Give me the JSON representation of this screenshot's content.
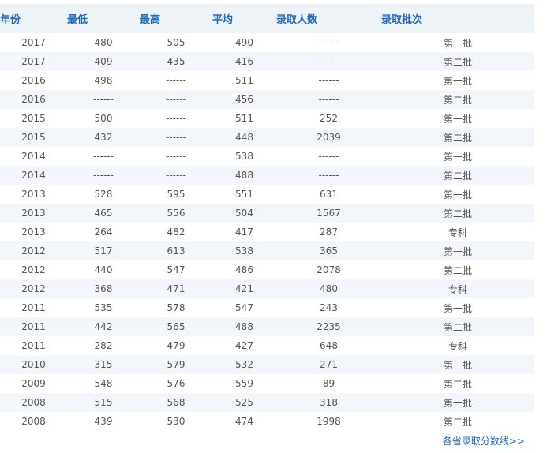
{
  "table": {
    "headers": {
      "year": "年份",
      "min": "最低",
      "max": "最高",
      "avg": "平均",
      "count": "录取人数",
      "batch": "录取批次"
    },
    "rows": [
      {
        "year": "2017",
        "min": "480",
        "max": "505",
        "avg": "490",
        "count": "------",
        "batch": "第一批"
      },
      {
        "year": "2017",
        "min": "409",
        "max": "435",
        "avg": "416",
        "count": "------",
        "batch": "第二批"
      },
      {
        "year": "2016",
        "min": "498",
        "max": "------",
        "avg": "511",
        "count": "------",
        "batch": "第一批"
      },
      {
        "year": "2016",
        "min": "------",
        "max": "------",
        "avg": "456",
        "count": "------",
        "batch": "第二批"
      },
      {
        "year": "2015",
        "min": "500",
        "max": "------",
        "avg": "511",
        "count": "252",
        "batch": "第一批"
      },
      {
        "year": "2015",
        "min": "432",
        "max": "------",
        "avg": "448",
        "count": "2039",
        "batch": "第二批"
      },
      {
        "year": "2014",
        "min": "------",
        "max": "------",
        "avg": "538",
        "count": "------",
        "batch": "第一批"
      },
      {
        "year": "2014",
        "min": "------",
        "max": "------",
        "avg": "488",
        "count": "------",
        "batch": "第二批"
      },
      {
        "year": "2013",
        "min": "528",
        "max": "595",
        "avg": "551",
        "count": "631",
        "batch": "第一批"
      },
      {
        "year": "2013",
        "min": "465",
        "max": "556",
        "avg": "504",
        "count": "1567",
        "batch": "第二批"
      },
      {
        "year": "2013",
        "min": "264",
        "max": "482",
        "avg": "417",
        "count": "287",
        "batch": "专科"
      },
      {
        "year": "2012",
        "min": "517",
        "max": "613",
        "avg": "538",
        "count": "365",
        "batch": "第一批"
      },
      {
        "year": "2012",
        "min": "440",
        "max": "547",
        "avg": "486",
        "count": "2078",
        "batch": "第二批"
      },
      {
        "year": "2012",
        "min": "368",
        "max": "471",
        "avg": "421",
        "count": "480",
        "batch": "专科"
      },
      {
        "year": "2011",
        "min": "535",
        "max": "578",
        "avg": "547",
        "count": "243",
        "batch": "第一批"
      },
      {
        "year": "2011",
        "min": "442",
        "max": "565",
        "avg": "488",
        "count": "2235",
        "batch": "第二批"
      },
      {
        "year": "2011",
        "min": "282",
        "max": "479",
        "avg": "427",
        "count": "648",
        "batch": "专科"
      },
      {
        "year": "2010",
        "min": "315",
        "max": "579",
        "avg": "532",
        "count": "271",
        "batch": "第一批"
      },
      {
        "year": "2009",
        "min": "548",
        "max": "576",
        "avg": "559",
        "count": "89",
        "batch": "第二批"
      },
      {
        "year": "2008",
        "min": "515",
        "max": "568",
        "avg": "525",
        "count": "318",
        "batch": "第一批"
      },
      {
        "year": "2008",
        "min": "439",
        "max": "530",
        "avg": "474",
        "count": "1998",
        "batch": "第二批"
      }
    ]
  },
  "footer": {
    "more_link": "各省录取分数线>>"
  },
  "colors": {
    "header_text": "#1e6bb8",
    "header_bg": "#eef3f8",
    "alt_row_bg": "#f3f7fb",
    "link": "#1e6bb8"
  }
}
